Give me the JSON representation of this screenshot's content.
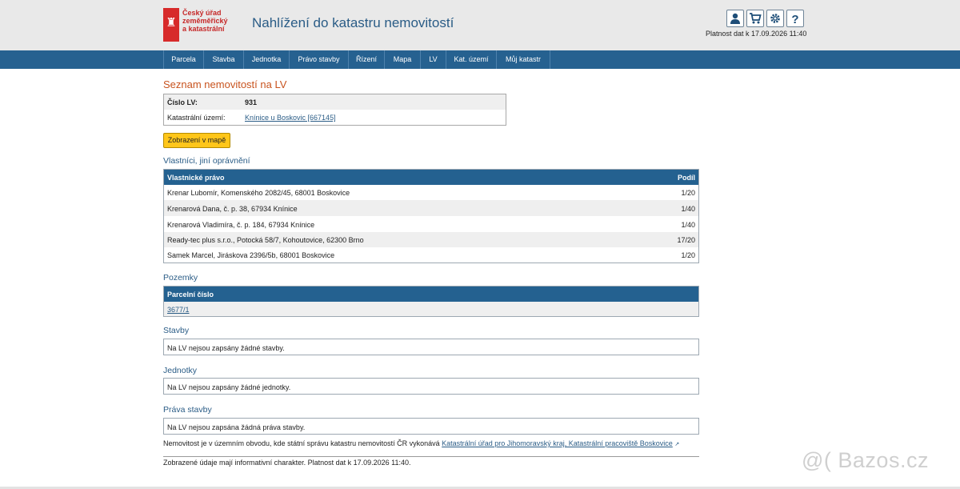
{
  "header": {
    "logo_lines": [
      "Český úřad",
      "zeměměřický",
      "a katastrální"
    ],
    "app_title": "Nahlížení do katastru nemovitostí",
    "validity": "Platnost dat k 17.09.2026 11:40",
    "icons": [
      "user-icon",
      "cart-icon",
      "gear-icon",
      "help-icon"
    ]
  },
  "nav": {
    "items": [
      "Parcela",
      "Stavba",
      "Jednotka",
      "Právo stavby",
      "Řízení",
      "Mapa",
      "LV",
      "Kat. území",
      "Můj katastr"
    ]
  },
  "page": {
    "title": "Seznam nemovitostí na LV",
    "info": {
      "lv_label": "Číslo LV:",
      "lv_value": "931",
      "ku_label": "Katastrální území:",
      "ku_value": "Knínice u Boskovic [667145]"
    },
    "map_button": "Zobrazení v mapě",
    "owners": {
      "heading": "Vlastníci, jiní oprávnění",
      "col1": "Vlastnické právo",
      "col2": "Podíl",
      "rows": [
        {
          "name": "Krenar Lubomír, Komenského 2082/45, 68001 Boskovice",
          "share": "1/20"
        },
        {
          "name": "Krenarová Dana, č. p. 38, 67934 Knínice",
          "share": "1/40"
        },
        {
          "name": "Krenarová Vladimíra, č. p. 184, 67934 Knínice",
          "share": "1/40"
        },
        {
          "name": "Ready-tec plus s.r.o., Potocká 58/7, Kohoutovice, 62300 Brno",
          "share": "17/20"
        },
        {
          "name": "Samek Marcel, Jiráskova 2396/5b, 68001 Boskovice",
          "share": "1/20"
        }
      ]
    },
    "parcels": {
      "heading": "Pozemky",
      "col1": "Parcelní číslo",
      "rows": [
        "3677/1"
      ]
    },
    "buildings": {
      "heading": "Stavby",
      "text": "Na LV nejsou zapsány žádné stavby."
    },
    "units": {
      "heading": "Jednotky",
      "text": "Na LV nejsou zapsány žádné jednotky."
    },
    "rights": {
      "heading": "Práva stavby",
      "text": "Na LV nejsou zapsána žádná práva stavby."
    },
    "office_note": "Nemovitost je v územním obvodu, kde státní správu katastru nemovitostí ČR vykonává",
    "office_link": "Katastrální úřad pro Jihomoravský kraj, Katastrální pracoviště Boskovice",
    "disclaimer": "Zobrazené údaje mají informativní charakter. Platnost dat k 17.09.2026 11:40."
  },
  "watermark": "@( Bazos.cz",
  "colors": {
    "nav": "#266190",
    "title": "#c8531e",
    "button": "#ffc61a",
    "table_head": "#246190"
  }
}
